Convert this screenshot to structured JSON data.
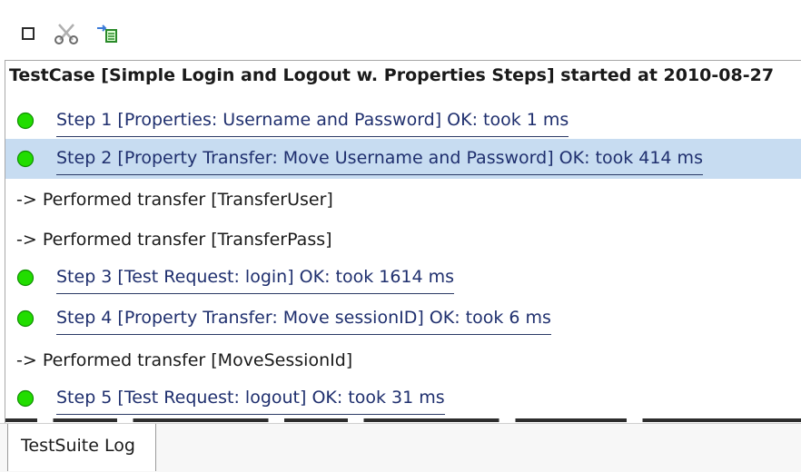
{
  "toolbar": {
    "icons": [
      "stop-icon",
      "scissors-icon",
      "export-icon"
    ]
  },
  "log": {
    "header": "TestCase [Simple Login and Logout w. Properties Steps] started at 2010-08-27",
    "entries": [
      {
        "type": "step",
        "status": "ok",
        "text": "Step 1 [Properties: Username and Password] OK: took 1 ms"
      },
      {
        "type": "step",
        "status": "ok",
        "text": "Step 2 [Property Transfer: Move Username and Password] OK: took 414 ms",
        "selected": true
      },
      {
        "type": "info",
        "text": "-> Performed transfer [TransferUser]"
      },
      {
        "type": "info",
        "text": "-> Performed transfer [TransferPass]"
      },
      {
        "type": "step",
        "status": "ok",
        "text": "Step 3 [Test Request: login] OK: took 1614 ms"
      },
      {
        "type": "step",
        "status": "ok",
        "text": "Step 4 [Property Transfer: Move sessionID] OK: took 6 ms"
      },
      {
        "type": "info",
        "text": "-> Performed transfer [MoveSessionId]"
      },
      {
        "type": "step",
        "status": "ok",
        "text": "Step 5 [Test Request: logout] OK: took 31 ms"
      }
    ],
    "status_color_ok": "#22dd00",
    "selected_color": "#c7dcf1"
  },
  "tabs": [
    {
      "label": "TestSuite Log",
      "active": true
    }
  ]
}
